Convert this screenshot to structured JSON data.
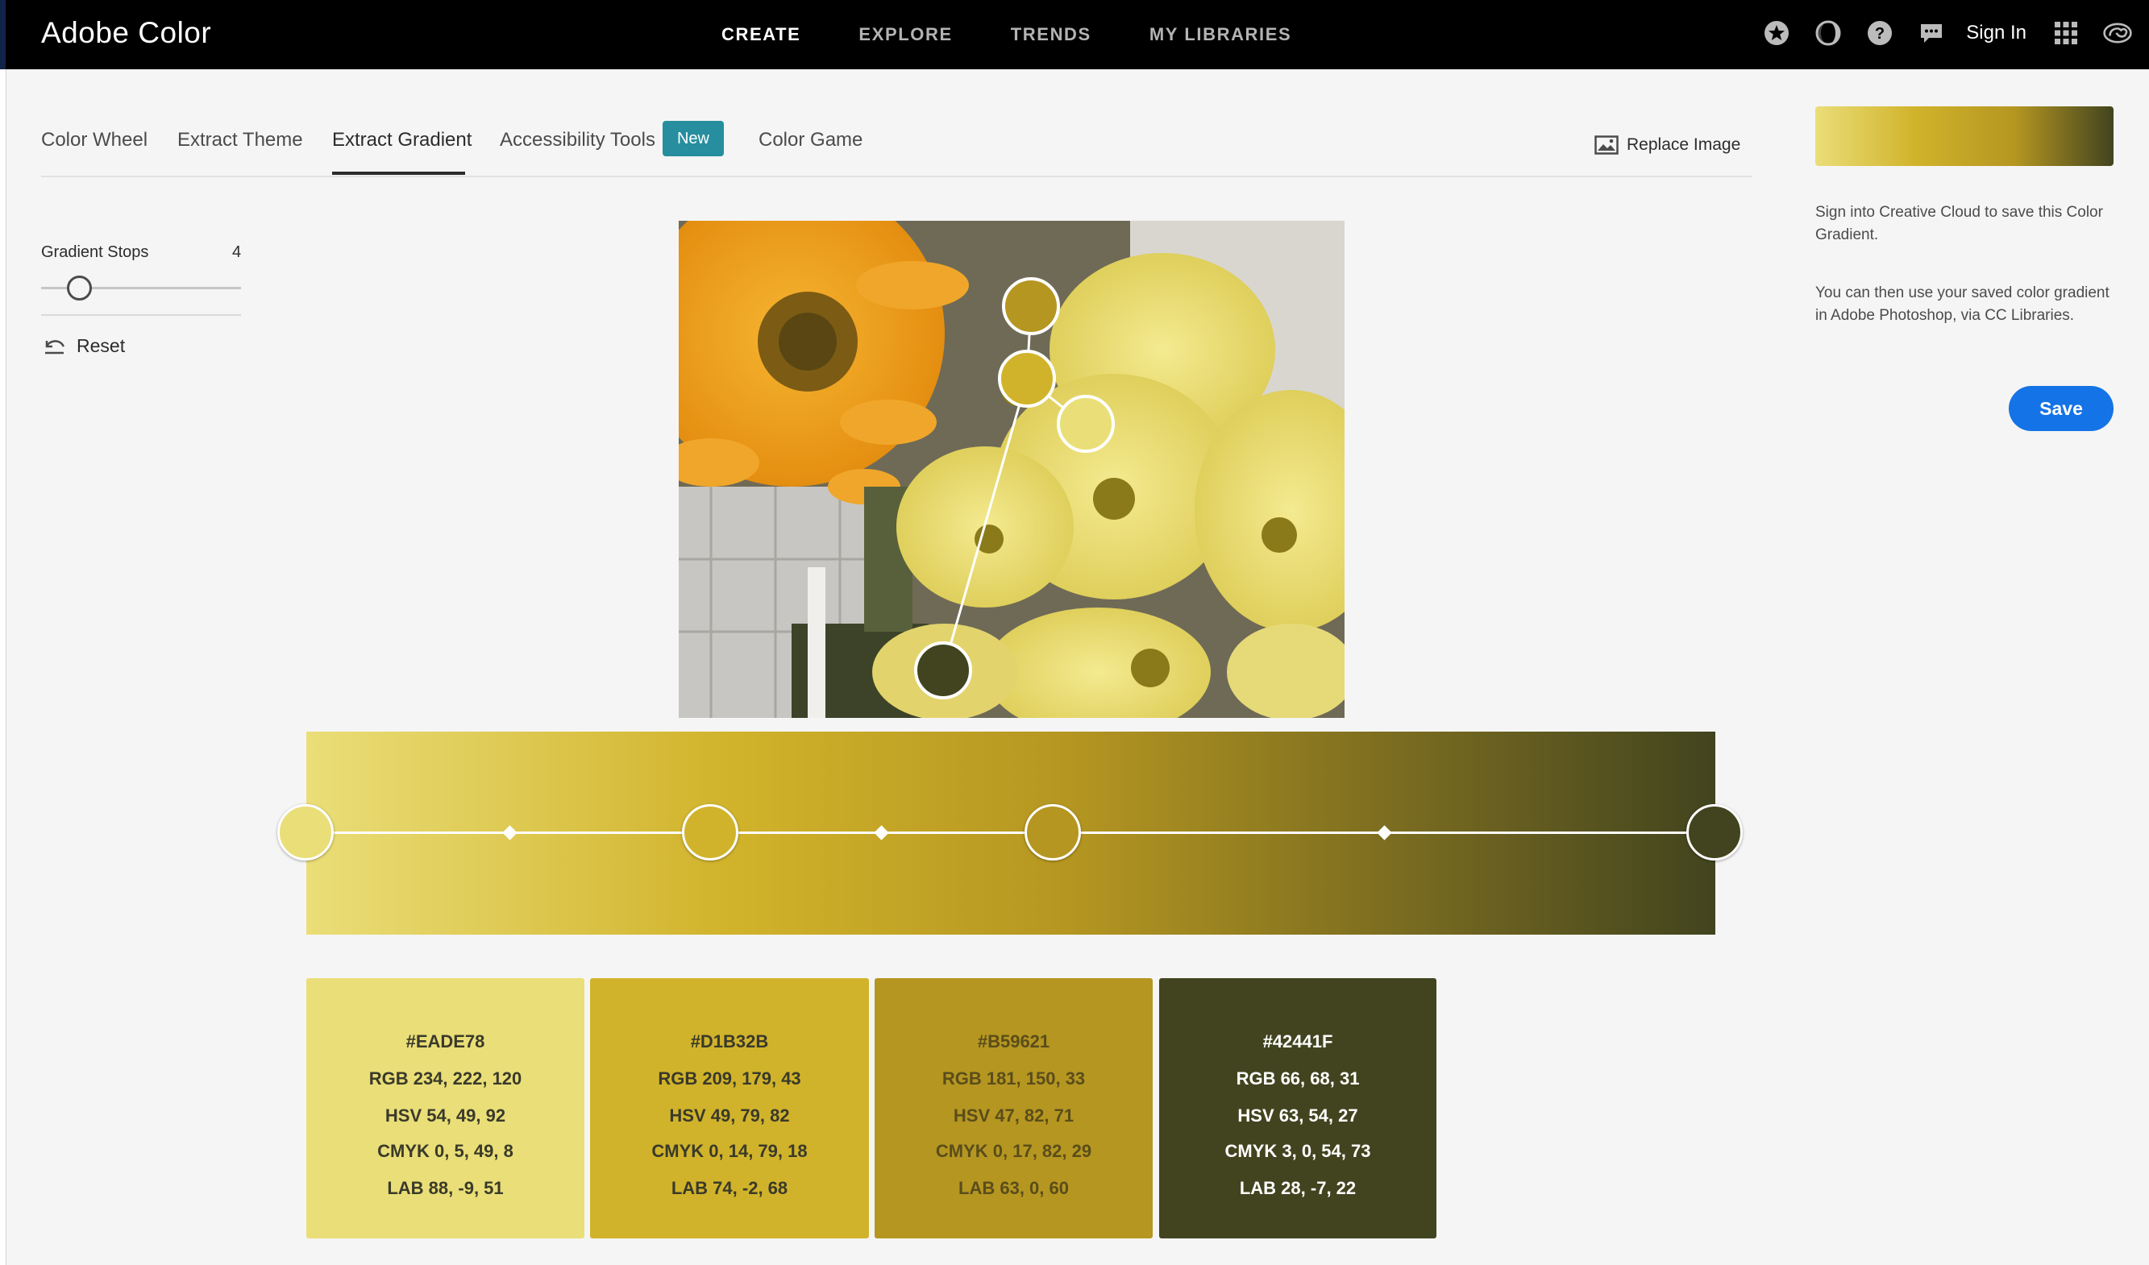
{
  "app": {
    "name": "Adobe Color"
  },
  "nav": {
    "links": [
      "CREATE",
      "EXPLORE",
      "TRENDS",
      "MY LIBRARIES"
    ],
    "sign_in": "Sign In"
  },
  "tabs": {
    "items": [
      "Color Wheel",
      "Extract Theme",
      "Extract Gradient",
      "Accessibility Tools",
      "Color Game"
    ],
    "active": "Extract Gradient",
    "new_badge": "New",
    "replace_image": "Replace Image"
  },
  "controls": {
    "gradient_stops_label": "Gradient Stops",
    "gradient_stops_value": "4",
    "reset_label": "Reset"
  },
  "gradient": {
    "stops": [
      "#EADE78",
      "#D1B32B",
      "#B59621",
      "#42441F"
    ]
  },
  "swatches": [
    {
      "hex": "#EADE78",
      "rgb": "RGB 234, 222, 120",
      "hsv": "HSV 54, 49, 92",
      "cmyk": "CMYK 0, 5, 49, 8",
      "lab": "LAB 88, -9, 51",
      "text_color": "#3a3a2a"
    },
    {
      "hex": "#D1B32B",
      "rgb": "RGB 209, 179, 43",
      "hsv": "HSV 49, 79, 82",
      "cmyk": "CMYK 0, 14, 79, 18",
      "lab": "LAB 74, -2, 68",
      "text_color": "#3a3a2a"
    },
    {
      "hex": "#B59621",
      "rgb": "RGB 181, 150, 33",
      "hsv": "HSV 47, 82, 71",
      "cmyk": "CMYK 0, 17, 82, 29",
      "lab": "LAB 63, 0, 60",
      "text_color": "#5a4d1a"
    },
    {
      "hex": "#42441F",
      "rgb": "RGB 66, 68, 31",
      "hsv": "HSV 63, 54, 27",
      "cmyk": "CMYK 3, 0, 54, 73",
      "lab": "LAB 28, -7, 22",
      "text_color": "#ffffff"
    }
  ],
  "side_panel": {
    "signin_note": "Sign into Creative Cloud to save this Color Gradient.",
    "use_note": "You can then use your saved color gradient in Adobe Photoshop, via CC Libraries.",
    "save_label": "Save"
  }
}
